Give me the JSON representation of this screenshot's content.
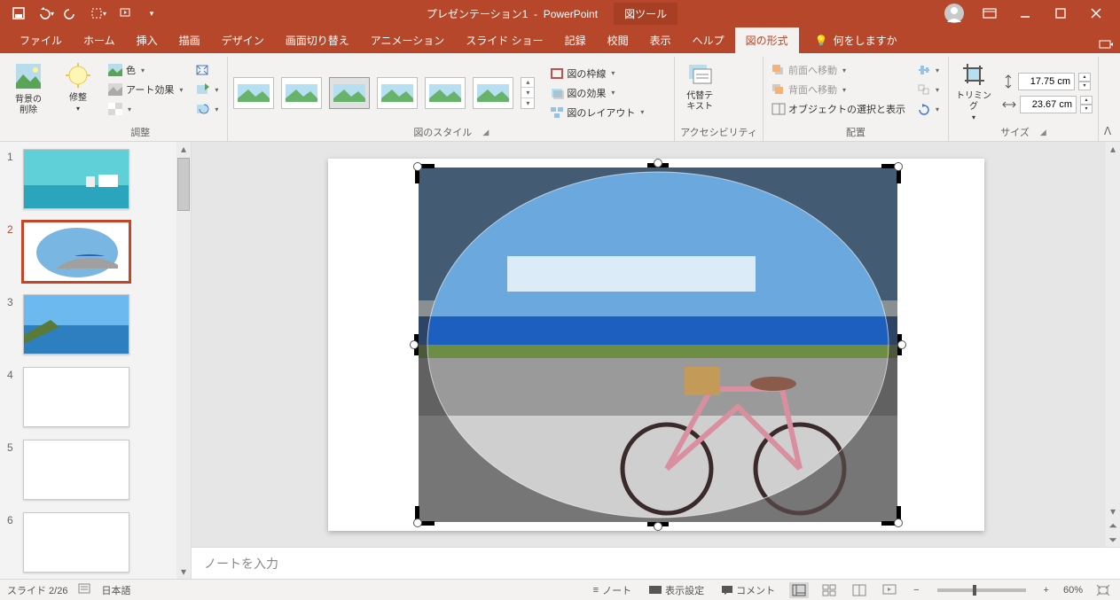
{
  "qat": {
    "save": "save-icon",
    "undo": "undo-icon",
    "redo": "redo-icon",
    "touch": "touch-icon",
    "start": "start-icon"
  },
  "title": {
    "doc": "プレゼンテーション1",
    "app": "PowerPoint",
    "tool_tab": "図ツール"
  },
  "tabs": {
    "file": "ファイル",
    "home": "ホーム",
    "insert": "挿入",
    "draw": "描画",
    "design": "デザイン",
    "transition": "画面切り替え",
    "animation": "アニメーション",
    "slideshow": "スライド ショー",
    "record": "記録",
    "review": "校閲",
    "view": "表示",
    "help": "ヘルプ",
    "picture_format": "図の形式",
    "tellme": "何をしますか"
  },
  "ribbon": {
    "remove_bg": "背景の\n削除",
    "corrections": "修整",
    "color": "色",
    "artistic": "アート効果",
    "adjust_label": "調整",
    "styles_label": "図のスタイル",
    "border": "図の枠線",
    "effects": "図の効果",
    "layout": "図のレイアウト",
    "alt_text": "代替テ\nキスト",
    "accessibility_label": "アクセシビリティ",
    "bring_forward": "前面へ移動",
    "send_backward": "背面へ移動",
    "selection_pane": "オブジェクトの選択と表示",
    "arrange_label": "配置",
    "crop": "トリミング",
    "size_label": "サイズ",
    "height": "17.75 cm",
    "width": "23.67 cm"
  },
  "thumbs": [
    1,
    2,
    3,
    4,
    5,
    6
  ],
  "selected_thumb": 2,
  "notes_placeholder": "ノートを入力",
  "status": {
    "slide": "スライド 2/26",
    "lang": "日本語",
    "notes": "ノート",
    "display": "表示設定",
    "comments": "コメント",
    "zoom": "60%"
  }
}
